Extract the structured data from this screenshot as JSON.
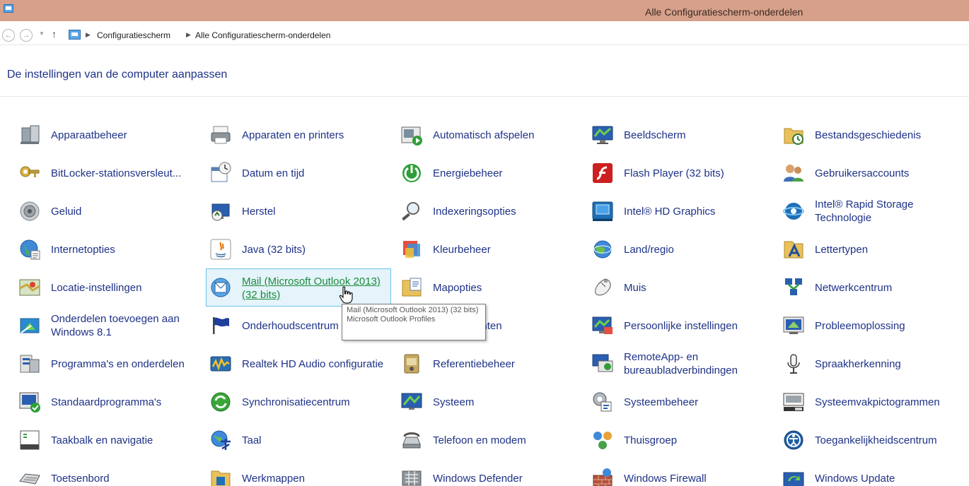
{
  "window": {
    "title": "Alle Configuratiescherm-onderdelen"
  },
  "breadcrumb": [
    "Configuratiescherm",
    "Alle Configuratiescherm-onderdelen"
  ],
  "heading": "De instellingen van de computer aanpassen",
  "items": [
    {
      "label": "Apparaatbeheer",
      "icon": "device-manager-icon"
    },
    {
      "label": "Apparaten en printers",
      "icon": "printer-icon"
    },
    {
      "label": "Automatisch afspelen",
      "icon": "autoplay-icon"
    },
    {
      "label": "Beeldscherm",
      "icon": "display-icon"
    },
    {
      "label": "Bestandsgeschiedenis",
      "icon": "file-history-icon"
    },
    {
      "label": "BitLocker-stationsversleut...",
      "icon": "bitlocker-key-icon"
    },
    {
      "label": "Datum en tijd",
      "icon": "calendar-clock-icon"
    },
    {
      "label": "Energiebeheer",
      "icon": "power-icon"
    },
    {
      "label": "Flash Player (32 bits)",
      "icon": "flash-icon"
    },
    {
      "label": "Gebruikersaccounts",
      "icon": "users-icon"
    },
    {
      "label": "Geluid",
      "icon": "speaker-icon"
    },
    {
      "label": "Herstel",
      "icon": "recovery-icon"
    },
    {
      "label": "Indexeringsopties",
      "icon": "indexing-icon"
    },
    {
      "label": "Intel® HD Graphics",
      "icon": "intel-graphics-icon"
    },
    {
      "label": "Intel® Rapid Storage Technologie",
      "icon": "intel-storage-icon"
    },
    {
      "label": "Internetopties",
      "icon": "internet-options-icon"
    },
    {
      "label": "Java (32 bits)",
      "icon": "java-icon"
    },
    {
      "label": "Kleurbeheer",
      "icon": "color-management-icon"
    },
    {
      "label": "Land/regio",
      "icon": "globe-region-icon"
    },
    {
      "label": "Lettertypen",
      "icon": "fonts-icon"
    },
    {
      "label": "Locatie-instellingen",
      "icon": "location-icon"
    },
    {
      "label": "Mail (Microsoft Outlook 2013) (32 bits)",
      "icon": "mail-icon"
    },
    {
      "label": "Mapopties",
      "icon": "folder-options-icon"
    },
    {
      "label": "Muis",
      "icon": "mouse-icon"
    },
    {
      "label": "Netwerkcentrum",
      "icon": "network-icon"
    },
    {
      "label": "Onderdelen toevoegen aan Windows 8.1",
      "icon": "add-features-icon"
    },
    {
      "label": "Onderhoudscentrum",
      "icon": "action-center-flag-icon"
    },
    {
      "label": "Opslagruimten",
      "icon": "storage-spaces-icon"
    },
    {
      "label": "Persoonlijke instellingen",
      "icon": "personalization-icon"
    },
    {
      "label": "Probleemoplossing",
      "icon": "troubleshooting-icon"
    },
    {
      "label": "Programma's en onderdelen",
      "icon": "programs-icon"
    },
    {
      "label": "Realtek HD Audio configuratie",
      "icon": "realtek-audio-icon"
    },
    {
      "label": "Referentiebeheer",
      "icon": "credential-manager-icon"
    },
    {
      "label": "RemoteApp- en bureaubladverbindingen",
      "icon": "remoteapp-icon"
    },
    {
      "label": "Spraakherkenning",
      "icon": "microphone-icon"
    },
    {
      "label": "Standaardprogramma's",
      "icon": "default-programs-icon"
    },
    {
      "label": "Synchronisatiecentrum",
      "icon": "sync-icon"
    },
    {
      "label": "Systeem",
      "icon": "system-icon"
    },
    {
      "label": "Systeembeheer",
      "icon": "admin-tools-icon"
    },
    {
      "label": "Systeemvakpictogrammen",
      "icon": "notification-area-icon"
    },
    {
      "label": "Taakbalk en navigatie",
      "icon": "taskbar-icon"
    },
    {
      "label": "Taal",
      "icon": "language-icon"
    },
    {
      "label": "Telefoon en modem",
      "icon": "phone-modem-icon"
    },
    {
      "label": "Thuisgroep",
      "icon": "homegroup-icon"
    },
    {
      "label": "Toegankelijkheidscentrum",
      "icon": "ease-of-access-icon"
    },
    {
      "label": "Toetsenbord",
      "icon": "keyboard-icon"
    },
    {
      "label": "Werkmappen",
      "icon": "work-folders-icon"
    },
    {
      "label": "Windows Defender",
      "icon": "windows-defender-icon"
    },
    {
      "label": "Windows Firewall",
      "icon": "firewall-icon"
    },
    {
      "label": "Windows Update",
      "icon": "windows-update-icon"
    }
  ],
  "hovered_item": "Mail (Microsoft Outlook 2013) (32 bits)",
  "tooltip": {
    "line1": "Mail (Microsoft Outlook 2013) (32 bits)",
    "line2": "Microsoft Outlook Profiles"
  },
  "colors": {
    "titlebar": "#d6a08a",
    "link": "#1e3287",
    "hover_link": "#1a8c3a",
    "hover_bg": "#e5f3fb",
    "hover_border": "#70c0e7"
  }
}
